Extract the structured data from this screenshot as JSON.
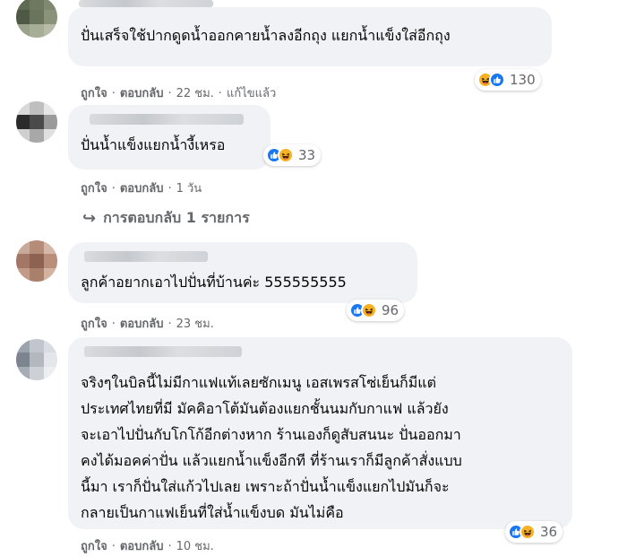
{
  "colors": {
    "bubble": "#f0f2f5",
    "meta": "#65676b",
    "like": "#1877f2",
    "haha": "#f7b125"
  },
  "comments": [
    {
      "text": "ปั่นเสร็จใช้ปากดูดน้ำออกคายน้ำลงอีกถุง แยกน้ำแข็งใส่อีกถุง",
      "reactions": {
        "icons": [
          "haha-icon",
          "like-icon"
        ],
        "count": "130"
      },
      "meta": {
        "like": "ถูกใจ",
        "reply": "ตอบกลับ",
        "time": "22 ชม.",
        "edited": "แก้ไขแล้ว"
      }
    },
    {
      "text": "ปั่นน้ำแข็งแยกน้ำงี้เหรอ",
      "reactions": {
        "icons": [
          "like-icon",
          "haha-icon"
        ],
        "count": "33"
      },
      "meta": {
        "like": "ถูกใจ",
        "reply": "ตอบกลับ",
        "time": "1 วัน"
      },
      "replies_label": "การตอบกลับ 1 รายการ"
    },
    {
      "text": "ลูกค้าอยากเอาไปปั่นที่บ้านค่ะ 555555555",
      "reactions": {
        "icons": [
          "like-icon",
          "haha-icon"
        ],
        "count": "96"
      },
      "meta": {
        "like": "ถูกใจ",
        "reply": "ตอบกลับ",
        "time": "23 ชม."
      }
    },
    {
      "text": "จริงๆในบิลนี้ไม่มีกาแฟแท้เลยซักเมนู เอสเพรสโซ่เย็นก็มีแต่\nประเทศไทยที่มี มัคคิอาโต้มันต้องแยกชั้นนมกับกาแฟ แล้วยัง\nจะเอาไปปั่นกับโกโก้อีกต่างหาก ร้านเองก็ดูสับสนนะ ปั่นออกมา\nคงได้มอคค่าปั่น แล้วแยกน้ำแข็งอีกที ที่ร้านเราก็มีลูกค้าสั่งแบบ\nนี้มา เราก็ปั่นใส่แก้วไปเลย เพราะถ้าปั่นน้ำแข็งแยกไปมันก็จะ\nกลายเป็นกาแฟเย็นที่ใส่น้ำแข็งบด มันไม่คือ",
      "reactions": {
        "icons": [
          "like-icon",
          "haha-icon"
        ],
        "count": "36"
      },
      "meta": {
        "like": "ถูกใจ",
        "reply": "ตอบกลับ",
        "time": "10 ชม."
      }
    }
  ]
}
